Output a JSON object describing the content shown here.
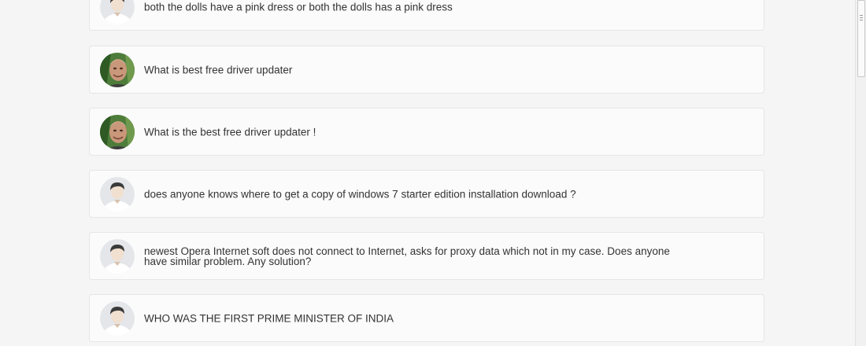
{
  "questions": [
    {
      "text": "both the dolls have a pink dress or both the dolls has a pink dress",
      "avatar": "default-user-avatar"
    },
    {
      "text": "What is best free driver updater",
      "avatar": "user-photo-avatar"
    },
    {
      "text": "What is the best free driver updater !",
      "avatar": "user-photo-avatar"
    },
    {
      "text": "does anyone knows where to get a copy of windows 7 starter edition installation download ?",
      "avatar": "default-user-avatar"
    },
    {
      "text": "newest Opera Internet soft does not connect to Internet, asks for proxy data which not in my case. Does anyone have similar problem. Any solution?",
      "avatar": "default-user-avatar"
    },
    {
      "text": "WHO WAS THE FIRST PRIME MINISTER OF INDIA",
      "avatar": "default-user-avatar"
    }
  ]
}
